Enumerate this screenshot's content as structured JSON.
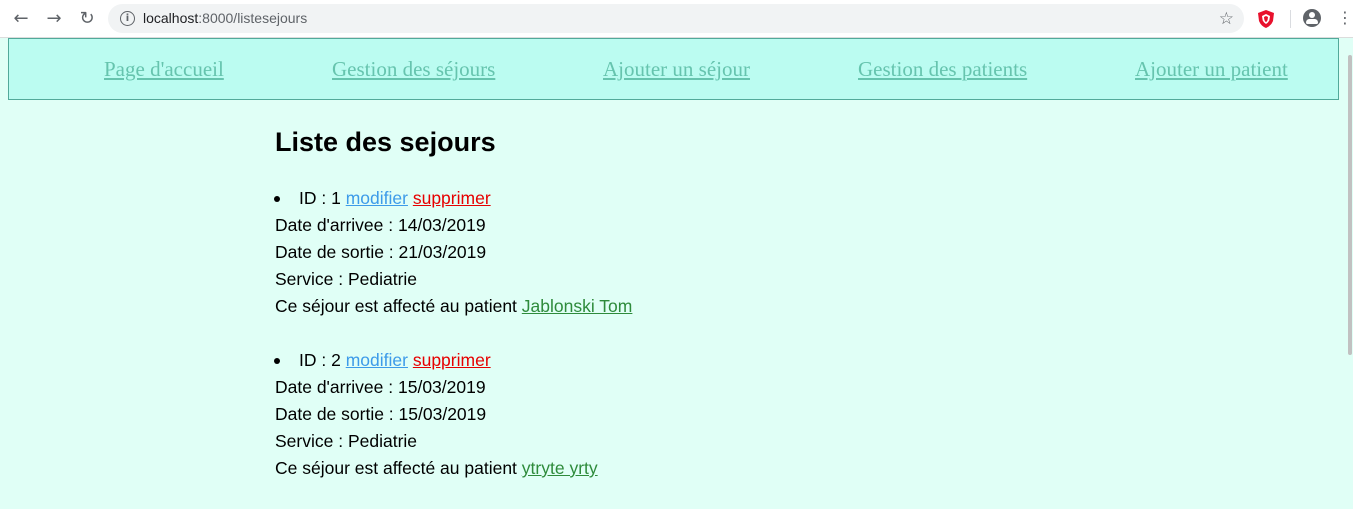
{
  "browser": {
    "url_host": "localhost",
    "url_rest": ":8000/listesejours"
  },
  "nav": {
    "items": [
      {
        "label": "Page d'accueil"
      },
      {
        "label": "Gestion des séjours"
      },
      {
        "label": "Ajouter un séjour"
      },
      {
        "label": "Gestion des patients"
      },
      {
        "label": "Ajouter un patient"
      }
    ]
  },
  "page": {
    "title": "Liste des sejours",
    "id_prefix": "ID :",
    "modify_label": "modifier",
    "delete_label": "supprimer",
    "arrival_prefix": "Date d'arrivee :",
    "departure_prefix": "Date de sortie :",
    "service_prefix": "Service :",
    "patient_prefix": "Ce séjour est affecté au patient"
  },
  "sejours": [
    {
      "id": "1",
      "arrival": "14/03/2019",
      "departure": "21/03/2019",
      "service": "Pediatrie",
      "patient": "Jablonski Tom"
    },
    {
      "id": "2",
      "arrival": "15/03/2019",
      "departure": "15/03/2019",
      "service": "Pediatrie",
      "patient": "ytryte yrty"
    }
  ],
  "colors": {
    "page_bg": "#e0fff6",
    "nav_bg": "#bbfcf1",
    "nav_link": "#66c4ae",
    "modify_link": "#3d9be9",
    "delete_link": "#e60000",
    "patient_link": "#2e8b3b"
  }
}
